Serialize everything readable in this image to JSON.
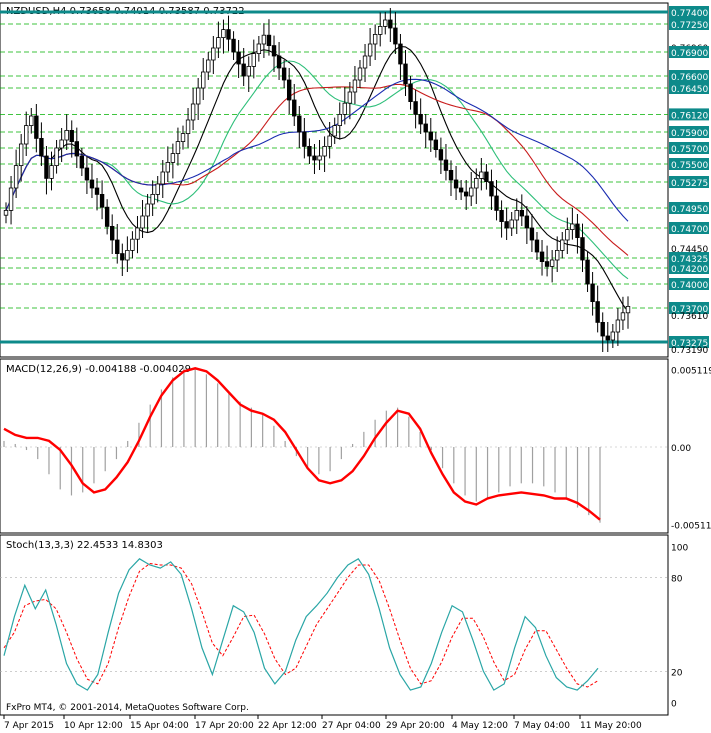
{
  "chart_data": [
    {
      "type": "candlestick",
      "panel": "price",
      "header": "NZDUSD,H4  0.73658 0.74014 0.73587 0.73722",
      "ylim": [
        0.7315,
        0.7745
      ],
      "y_ticks": [
        "0.77400",
        "0.77250",
        "0.76960",
        "0.76900",
        "0.76600",
        "0.76450",
        "0.76120",
        "0.75900",
        "0.75700",
        "0.75500",
        "0.75275",
        "0.74960",
        "0.74950",
        "0.74700",
        "0.74450",
        "0.74325",
        "0.74200",
        "0.74000",
        "0.73700",
        "0.73610",
        "0.73275",
        "0.73190"
      ],
      "highlighted_levels": [
        "0.77400",
        "0.77250",
        "0.76900",
        "0.76600",
        "0.76450",
        "0.76120",
        "0.75900",
        "0.75700",
        "0.75500",
        "0.75275",
        "0.74950",
        "0.74700",
        "0.74325",
        "0.74200",
        "0.74000",
        "0.73700"
      ],
      "support_resistance": [
        "0.77400",
        "0.73275"
      ],
      "closes": [
        0.7492,
        0.752,
        0.7548,
        0.7575,
        0.7598,
        0.761,
        0.7582,
        0.756,
        0.7532,
        0.7548,
        0.757,
        0.758,
        0.7592,
        0.7578,
        0.756,
        0.7545,
        0.753,
        0.752,
        0.7512,
        0.7496,
        0.7472,
        0.7455,
        0.7438,
        0.743,
        0.7442,
        0.7456,
        0.747,
        0.7485,
        0.75,
        0.7512,
        0.7525,
        0.754,
        0.7552,
        0.7563,
        0.7578,
        0.7588,
        0.7605,
        0.7625,
        0.7645,
        0.7665,
        0.768,
        0.7695,
        0.7708,
        0.7718,
        0.7706,
        0.769,
        0.7675,
        0.766,
        0.7672,
        0.7688,
        0.77,
        0.7711,
        0.7698,
        0.7685,
        0.767,
        0.7655,
        0.763,
        0.761,
        0.759,
        0.7572,
        0.756,
        0.7555,
        0.756,
        0.7572,
        0.7585,
        0.7598,
        0.7612,
        0.7626,
        0.764,
        0.7655,
        0.767,
        0.7685,
        0.77,
        0.7712,
        0.7722,
        0.773,
        0.772,
        0.77,
        0.7675,
        0.765,
        0.7628,
        0.7612,
        0.76,
        0.759,
        0.758,
        0.7568,
        0.7555,
        0.7542,
        0.753,
        0.752,
        0.7515,
        0.751,
        0.752,
        0.7532,
        0.754,
        0.7528,
        0.751,
        0.7492,
        0.7478,
        0.747,
        0.748,
        0.7492,
        0.7485,
        0.747,
        0.7455,
        0.744,
        0.7428,
        0.7422,
        0.743,
        0.7442,
        0.7455,
        0.7468,
        0.7475,
        0.7458,
        0.743,
        0.74,
        0.7378,
        0.7352,
        0.7335,
        0.733,
        0.734,
        0.7355,
        0.7364,
        0.7372
      ]
    },
    {
      "type": "indicator",
      "panel": "macd",
      "label": "MACD(12,26,9) -0.004188 -0.004029",
      "ylim": [
        -0.00535,
        0.00535
      ],
      "y_ticks": [
        "0.005119",
        "0.00",
        "-0.005116"
      ],
      "histogram": [
        0.0004,
        0.0002,
        -0.0002,
        -0.0008,
        -0.0018,
        -0.0028,
        -0.0032,
        -0.003,
        -0.0024,
        -0.0016,
        -0.0008,
        0.0004,
        0.0016,
        0.0028,
        0.0038,
        0.0046,
        0.0052,
        0.0052,
        0.0048,
        0.0042,
        0.0036,
        0.003,
        0.0026,
        0.0022,
        0.0014,
        0.0004,
        -0.0006,
        -0.0014,
        -0.0018,
        -0.0016,
        -0.0008,
        0.0002,
        0.001,
        0.0018,
        0.0024,
        0.0026,
        0.002,
        0.001,
        -0.0002,
        -0.0014,
        -0.0024,
        -0.0032,
        -0.0036,
        -0.0034,
        -0.003,
        -0.0026,
        -0.0024,
        -0.0024,
        -0.0026,
        -0.003,
        -0.0034,
        -0.004,
        -0.0045,
        -0.005
      ],
      "signal": [
        0.0012,
        0.0008,
        0.0006,
        0.0006,
        0.0004,
        -0.0002,
        -0.0012,
        -0.0024,
        -0.003,
        -0.0028,
        -0.002,
        -0.001,
        0.0004,
        0.002,
        0.0034,
        0.0044,
        0.005,
        0.0052,
        0.005,
        0.0044,
        0.0036,
        0.0028,
        0.0024,
        0.0022,
        0.0018,
        0.001,
        -0.0002,
        -0.0014,
        -0.0022,
        -0.0024,
        -0.0022,
        -0.0016,
        -0.0006,
        0.0006,
        0.0016,
        0.0024,
        0.0022,
        0.0012,
        -0.0004,
        -0.0018,
        -0.003,
        -0.0036,
        -0.0038,
        -0.0034,
        -0.0032,
        -0.0031,
        -0.003,
        -0.0031,
        -0.0032,
        -0.0034,
        -0.0034,
        -0.0037,
        -0.0042,
        -0.0048
      ]
    },
    {
      "type": "indicator",
      "panel": "stochastic",
      "label": "Stoch(13,3,3) 22.4533 14.8303",
      "ylim": [
        -6,
        104
      ],
      "y_ticks": [
        "100",
        "80",
        "20",
        "0"
      ],
      "main": [
        30,
        55,
        75,
        60,
        72,
        50,
        25,
        12,
        8,
        18,
        45,
        70,
        85,
        92,
        88,
        86,
        90,
        82,
        60,
        35,
        18,
        40,
        62,
        58,
        45,
        22,
        12,
        20,
        40,
        55,
        62,
        70,
        80,
        88,
        92,
        82,
        60,
        35,
        18,
        8,
        10,
        25,
        45,
        62,
        58,
        40,
        20,
        8,
        12,
        35,
        55,
        48,
        30,
        16,
        10,
        8,
        14,
        22
      ],
      "signal": [
        35,
        45,
        62,
        65,
        66,
        60,
        45,
        28,
        15,
        12,
        25,
        48,
        68,
        84,
        89,
        88,
        88,
        86,
        76,
        58,
        38,
        30,
        42,
        55,
        56,
        44,
        28,
        18,
        22,
        36,
        50,
        60,
        70,
        80,
        88,
        88,
        78,
        60,
        40,
        22,
        12,
        14,
        26,
        42,
        54,
        54,
        42,
        26,
        14,
        18,
        34,
        46,
        46,
        34,
        22,
        12,
        10,
        14
      ]
    },
    {
      "type": "axis",
      "x_labels": [
        "7 Apr 2015",
        "10 Apr 12:00",
        "15 Apr 04:00",
        "17 Apr 20:00",
        "22 Apr 12:00",
        "27 Apr 04:00",
        "29 Apr 20:00",
        "4 May 12:00",
        "7 May 04:00",
        "11 May 20:00"
      ]
    }
  ],
  "footer": "FxPro MT4, © 2001-2014, MetaQuotes Software Corp.",
  "colors": {
    "candle": "#000000",
    "grid_line": "#00b000",
    "level_box": "#0d8a8a",
    "level_text": "#ffffff",
    "ma_black": "#000000",
    "ma_red": "#c81c1c",
    "ma_green": "#2ebf7a",
    "ma_blue": "#1a2cb0",
    "macd_hist": "#a0a0a0",
    "macd_signal": "#ff0000",
    "stoch_main": "#2aa6a6",
    "stoch_signal": "#ff0000"
  }
}
